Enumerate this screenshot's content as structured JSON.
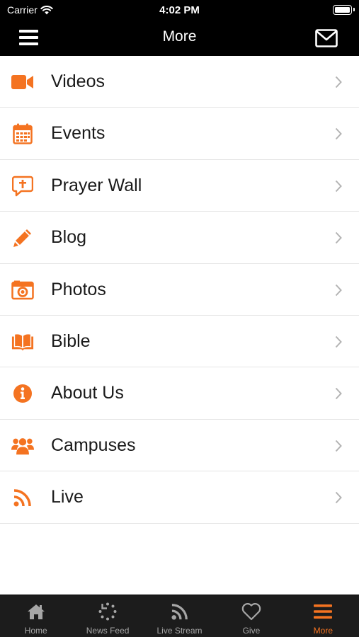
{
  "status_bar": {
    "carrier": "Carrier",
    "time": "4:02 PM"
  },
  "header": {
    "title": "More",
    "menu_icon": "hamburger-icon",
    "mail_icon": "mail-icon"
  },
  "colors": {
    "accent": "#f47321",
    "bar": "#000000",
    "tabbar": "#1c1c1c",
    "inactive": "#a6a6a6"
  },
  "menu": {
    "items": [
      {
        "label": "Videos",
        "icon": "video-camera-icon"
      },
      {
        "label": "Events",
        "icon": "calendar-icon"
      },
      {
        "label": "Prayer Wall",
        "icon": "prayer-bubble-icon"
      },
      {
        "label": "Blog",
        "icon": "pencil-icon"
      },
      {
        "label": "Photos",
        "icon": "camera-icon"
      },
      {
        "label": "Bible",
        "icon": "open-book-icon"
      },
      {
        "label": "About Us",
        "icon": "info-icon"
      },
      {
        "label": "Campuses",
        "icon": "users-icon"
      },
      {
        "label": "Live",
        "icon": "rss-icon"
      }
    ]
  },
  "tabbar": {
    "tabs": [
      {
        "label": "Home",
        "icon": "home-icon",
        "active": false
      },
      {
        "label": "News Feed",
        "icon": "refresh-icon",
        "active": false
      },
      {
        "label": "Live Stream",
        "icon": "rss-icon",
        "active": false
      },
      {
        "label": "Give",
        "icon": "heart-icon",
        "active": false
      },
      {
        "label": "More",
        "icon": "menu-icon",
        "active": true
      }
    ]
  }
}
